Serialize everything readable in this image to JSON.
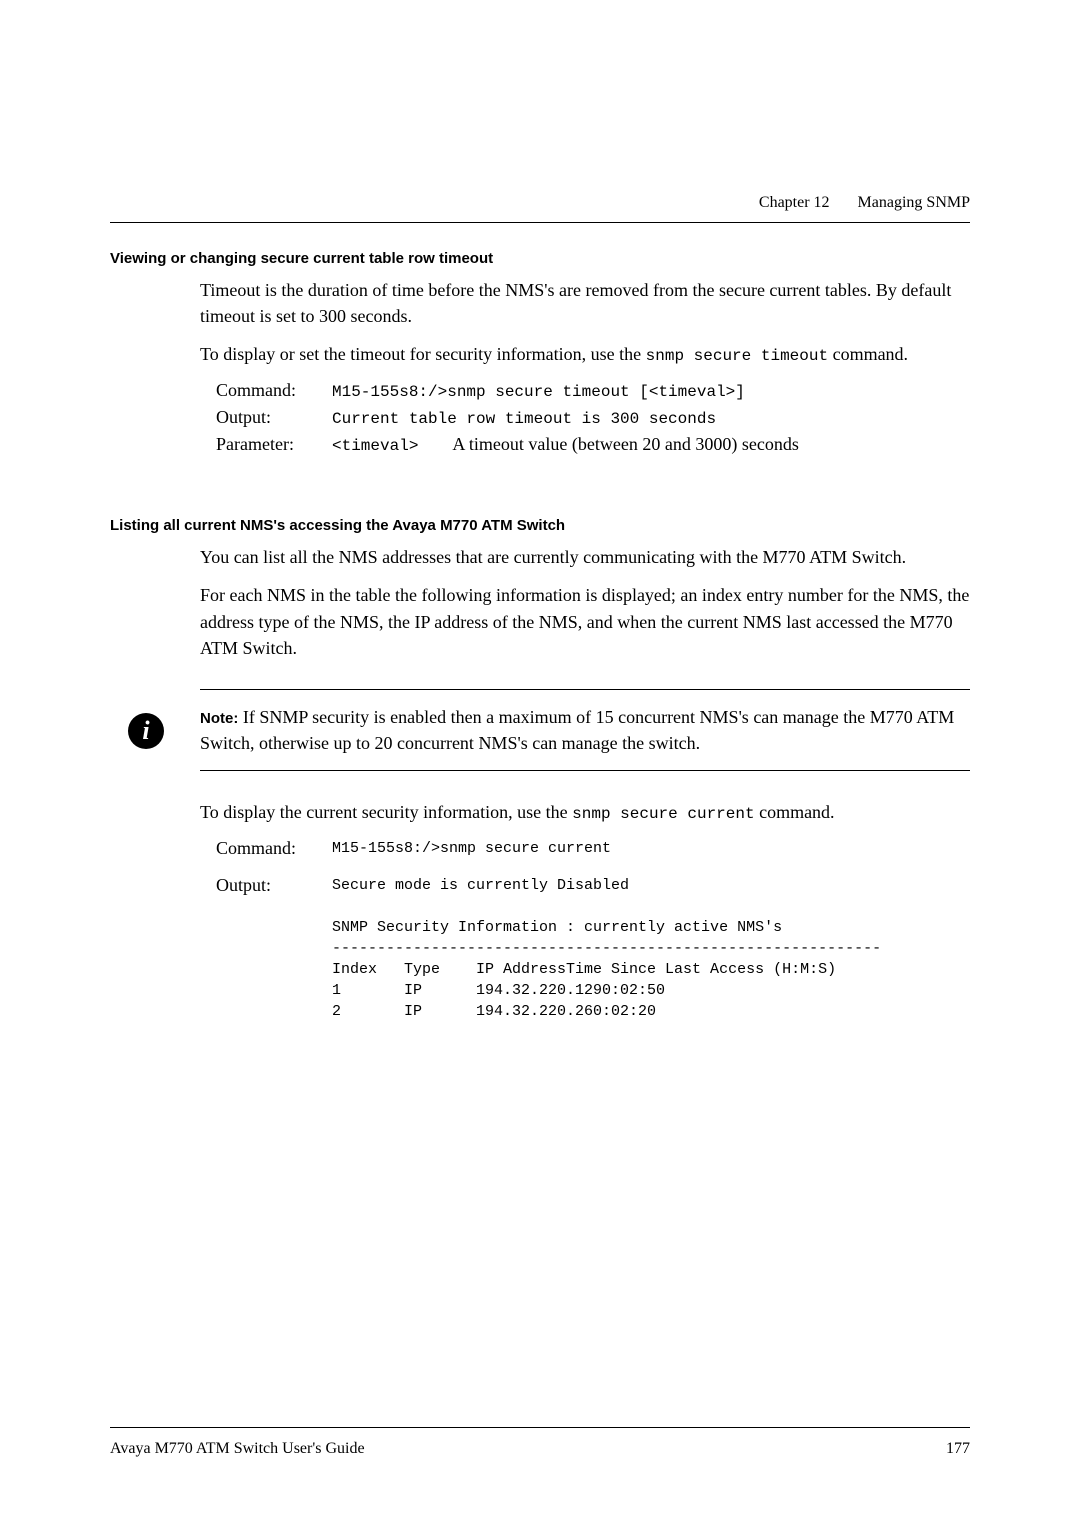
{
  "header": {
    "chapter": "Chapter 12",
    "title": "Managing SNMP"
  },
  "section1": {
    "heading": "Viewing or changing secure current table row timeout",
    "para1": "Timeout is the duration of time before the NMS's are removed from the secure current tables. By default timeout is set to 300 seconds.",
    "para2_pre": "To display or set the timeout for security information, use the ",
    "para2_cmd": "snmp secure timeout",
    "para2_post": " command.",
    "cmd": {
      "labelCommand": "Command:",
      "valCommand": "M15-155s8:/>snmp secure timeout [<timeval>]",
      "labelOutput": "Output:",
      "valOutput": "Current table row timeout is 300 seconds",
      "labelParameter": "Parameter:",
      "paramName": "<timeval>",
      "paramDesc": "A timeout value (between 20 and 3000) seconds"
    }
  },
  "section2": {
    "heading": "Listing all current NMS's accessing the Avaya M770 ATM Switch",
    "para1": "You can list all the NMS addresses that are currently communicating with the M770 ATM Switch.",
    "para2": "For each NMS in the table the following information is displayed; an index entry number for the NMS, the address type of the NMS, the IP address of the NMS, and when the current NMS last accessed the M770 ATM Switch.",
    "note": {
      "label": "Note:",
      "text": " If SNMP security is enabled then a maximum of 15 concurrent NMS's can manage the M770 ATM Switch, otherwise up to 20 concurrent NMS's can manage the switch."
    },
    "para3_pre": "To display the current security information, use the ",
    "para3_cmd": "snmp secure current",
    "para3_post": " command.",
    "cmd": {
      "labelCommand": "Command:",
      "valCommand": "M15-155s8:/>snmp secure current",
      "labelOutput": "Output:",
      "outputText": "Secure mode is currently Disabled\n\nSNMP Security Information : currently active NMS's\n-------------------------------------------------------------\nIndex   Type    IP AddressTime Since Last Access (H:M:S)\n1       IP      194.32.220.1290:02:50\n2       IP      194.32.220.260:02:20"
    }
  },
  "footer": {
    "left": "Avaya M770 ATM Switch User's Guide",
    "right": "177"
  }
}
